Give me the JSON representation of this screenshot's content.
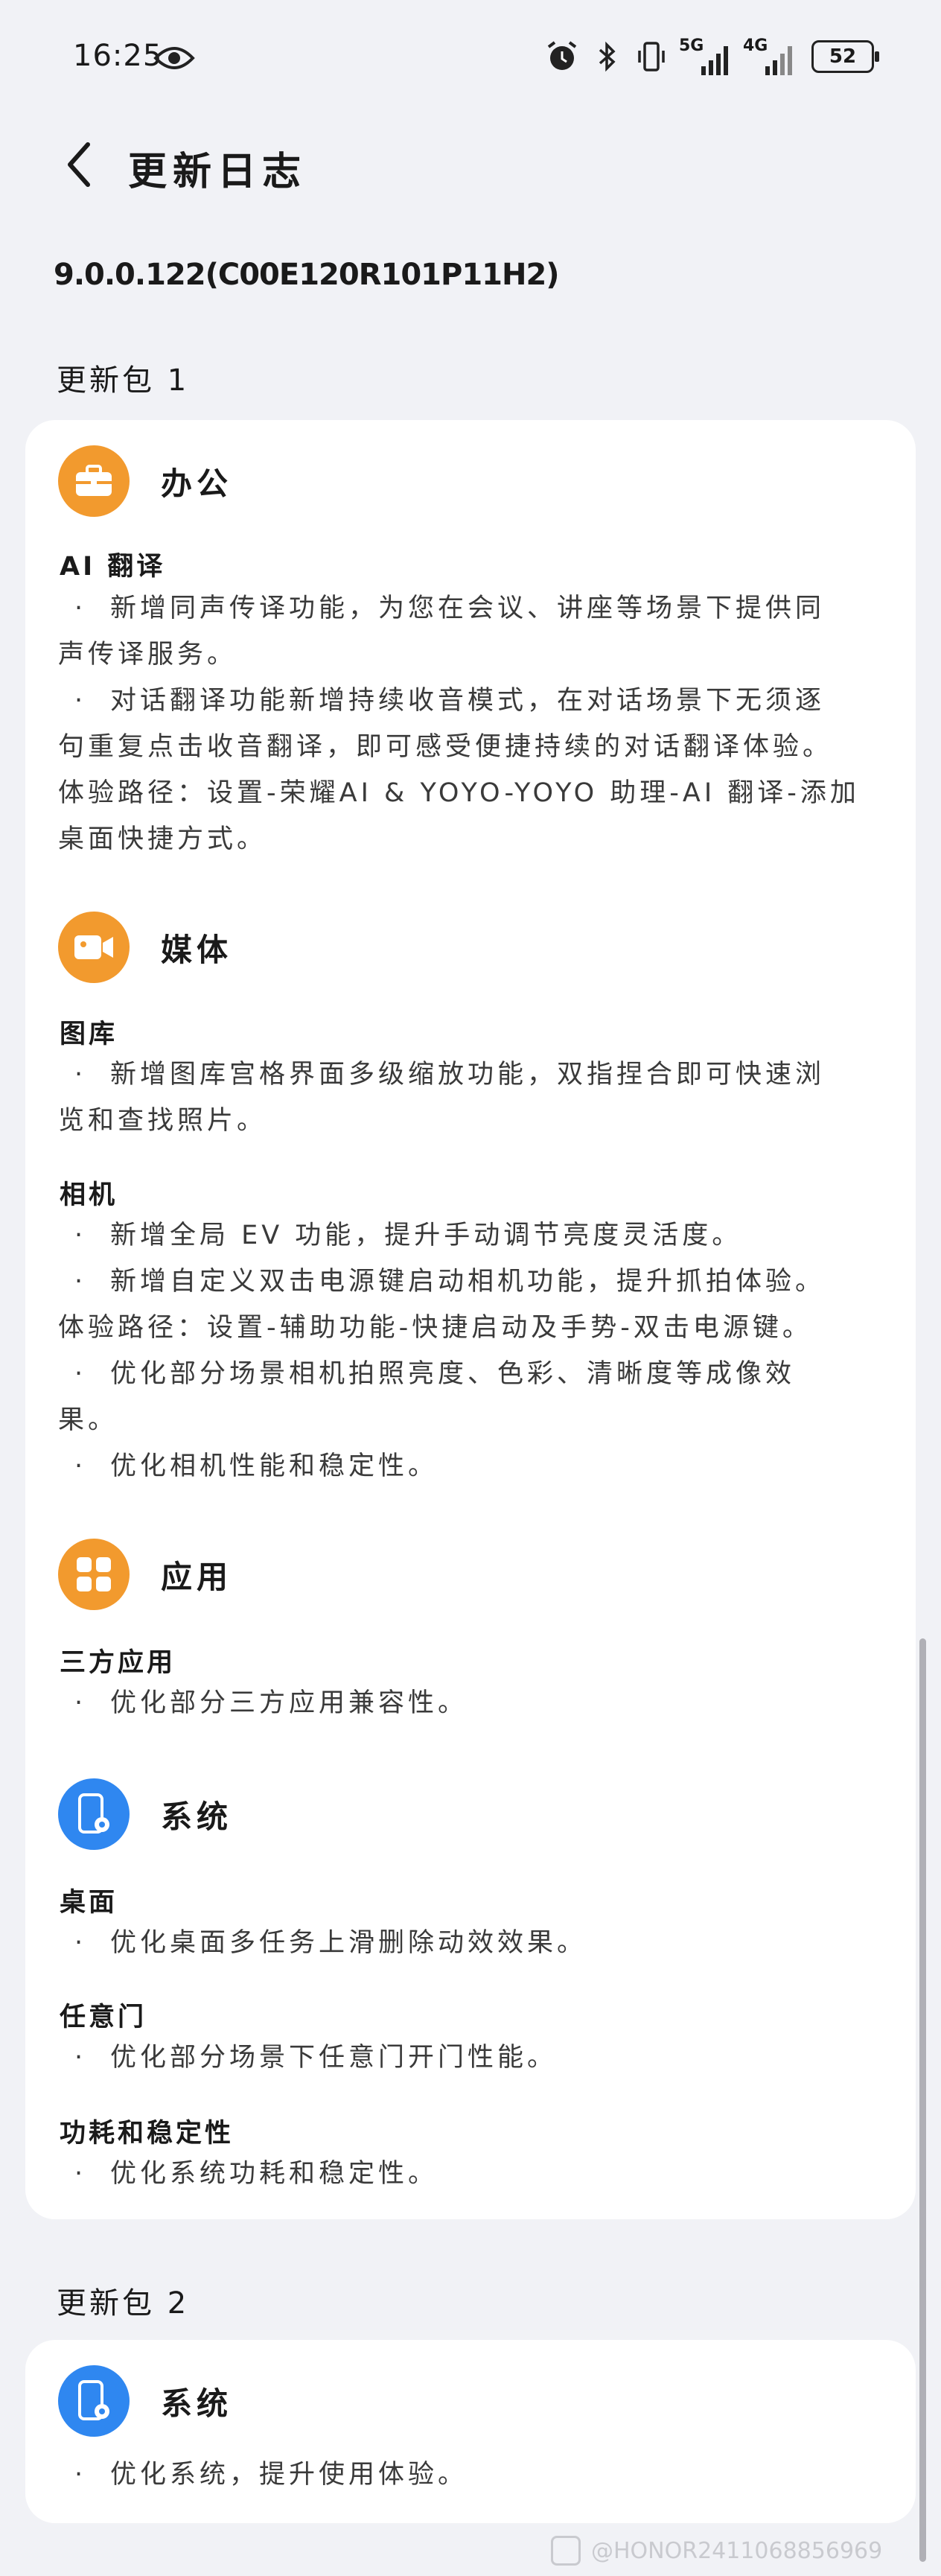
{
  "status_bar": {
    "time": "16:25",
    "network1": "5G",
    "network2": "4G",
    "battery": "52",
    "icons": [
      "eye-icon",
      "alarm-icon",
      "bluetooth-icon",
      "vibrate-icon",
      "signal-icon",
      "battery-icon"
    ]
  },
  "header": {
    "title": "更新日志"
  },
  "version": "9.0.0.122(C00E120R101P11H2)",
  "packages": [
    {
      "label": "更新包 1",
      "categories": [
        {
          "title": "办公",
          "icon": "briefcase-icon",
          "sections": [
            {
              "title": "AI 翻译",
              "lines": [
                "新增同声传译功能，为您在会议、讲座等场景下提供同",
                "声传译服务。",
                "对话翻译功能新增持续收音模式，在对话场景下无须逐",
                "句重复点击收音翻译，即可感受便捷持续的对话翻译体验。",
                "体验路径：设置-荣耀AI & YOYO-YOYO 助理-AI 翻译-添加",
                "桌面快捷方式。"
              ]
            }
          ]
        },
        {
          "title": "媒体",
          "icon": "video-camera-icon",
          "sections": [
            {
              "title": "图库",
              "lines": [
                "新增图库宫格界面多级缩放功能，双指捏合即可快速浏",
                "览和查找照片。"
              ]
            },
            {
              "title": "相机",
              "lines": [
                "新增全局 EV 功能，提升手动调节亮度灵活度。",
                "新增自定义双击电源键启动相机功能，提升抓拍体验。",
                "体验路径：设置-辅助功能-快捷启动及手势-双击电源键。",
                "优化部分场景相机拍照亮度、色彩、清晰度等成像效",
                "果。",
                "优化相机性能和稳定性。"
              ]
            }
          ]
        },
        {
          "title": "应用",
          "icon": "apps-grid-icon",
          "sections": [
            {
              "title": "三方应用",
              "lines": [
                "优化部分三方应用兼容性。"
              ]
            }
          ]
        },
        {
          "title": "系统",
          "icon": "phone-settings-icon",
          "sections": [
            {
              "title": "桌面",
              "lines": [
                "优化桌面多任务上滑删除动效效果。"
              ]
            },
            {
              "title": "任意门",
              "lines": [
                "优化部分场景下任意门开门性能。"
              ]
            },
            {
              "title": "功耗和稳定性",
              "lines": [
                "优化系统功耗和稳定性。"
              ]
            }
          ]
        }
      ]
    },
    {
      "label": "更新包 2",
      "categories": [
        {
          "title": "系统",
          "icon": "phone-settings-icon",
          "sections": [
            {
              "title": "",
              "lines": [
                "优化系统，提升使用体验。"
              ]
            }
          ]
        }
      ]
    }
  ],
  "watermark": "@HONOR2411068856969",
  "colors": {
    "background": "#f1f2f6",
    "card": "#ffffff",
    "orange_icon": "#f29a2e",
    "blue_icon": "#2f87f0"
  }
}
